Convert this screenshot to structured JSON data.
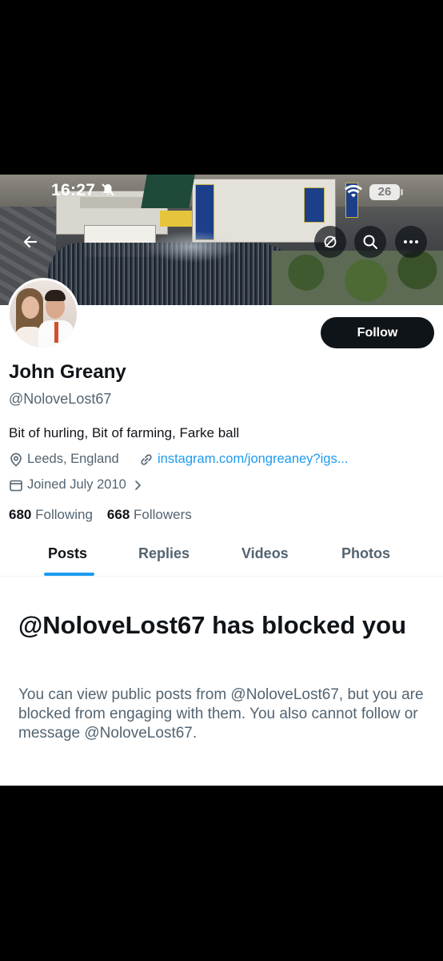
{
  "status_bar": {
    "time": "16:27",
    "battery": "26"
  },
  "banner_icons": [
    "back-arrow-icon",
    "sync-icon",
    "search-icon",
    "more-icon"
  ],
  "profile": {
    "follow_label": "Follow",
    "name": "John Greany",
    "handle": "@NoloveLost67",
    "bio": "Bit of hurling, Bit of farming, Farke ball",
    "location": "Leeds, England",
    "link": "instagram.com/jongreaney?igs...",
    "joined": "Joined July 2010",
    "following_count": "680",
    "following_label": "Following",
    "followers_count": "668",
    "followers_label": "Followers"
  },
  "tabs": [
    {
      "label": "Posts",
      "active": true
    },
    {
      "label": "Replies",
      "active": false
    },
    {
      "label": "Videos",
      "active": false
    },
    {
      "label": "Photos",
      "active": false
    }
  ],
  "blocked": {
    "title": "@NoloveLost67 has blocked you",
    "body": "You can view public posts from @NoloveLost67, but you are blocked from engaging with them. You also cannot follow or message @NoloveLost67."
  },
  "colors": {
    "accent": "#1d9bf0",
    "text_primary": "#0f1419",
    "text_secondary": "#536471"
  }
}
